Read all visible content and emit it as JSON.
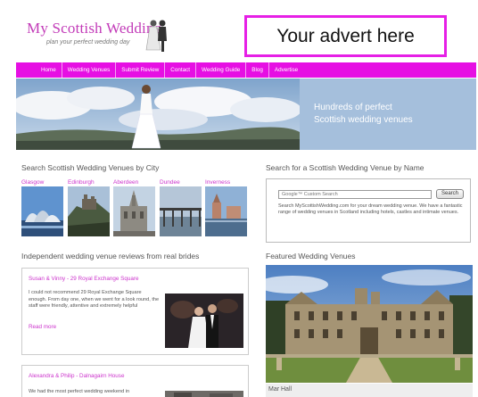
{
  "header": {
    "logo_title": "My Scottish Wedding",
    "logo_tagline": "plan your perfect wedding day",
    "advert": "Your advert here"
  },
  "nav": {
    "items": [
      "Home",
      "Wedding Venues",
      "Submit Review",
      "Contact",
      "Wedding Guide",
      "Blog",
      "Advertise"
    ]
  },
  "hero": {
    "line1": "Hundreds of perfect",
    "line2": "Scottish wedding venues"
  },
  "city_section": {
    "title": "Search Scottish Wedding Venues by City",
    "cities": [
      "Glasgow",
      "Edinburgh",
      "Aberdeen",
      "Dundee",
      "Inverness"
    ]
  },
  "search_section": {
    "title": "Search for a Scottish Wedding Venue by Name",
    "placeholder": "Google™ Custom Search",
    "button": "Search",
    "description": "Search MyScottishWedding.com for your dream wedding venue. We have a fantastic range of wedding venues in Scotland including hotels, castles and intimate venues."
  },
  "reviews_section": {
    "title": "Independent wedding venue reviews from real brides",
    "reviews": [
      {
        "title": "Susan & Vinny - 29 Royal Exchange Square",
        "body": "I could not recommend 29 Royal Exchange Square enough. From day one, when we went for a look round, the staff were friendly, attentive and extremely helpful",
        "link": "Read more"
      },
      {
        "title": "Alexandra & Philip - Dalnagairn House",
        "body": "We had the most perfect wedding weekend in"
      }
    ]
  },
  "featured_section": {
    "title": "Featured Wedding Venues",
    "caption": "Mar Hall"
  },
  "colors": {
    "brand_pink": "#e60fe3",
    "link_pink": "#cc33cc",
    "hero_panel": "#a5bfdc"
  }
}
